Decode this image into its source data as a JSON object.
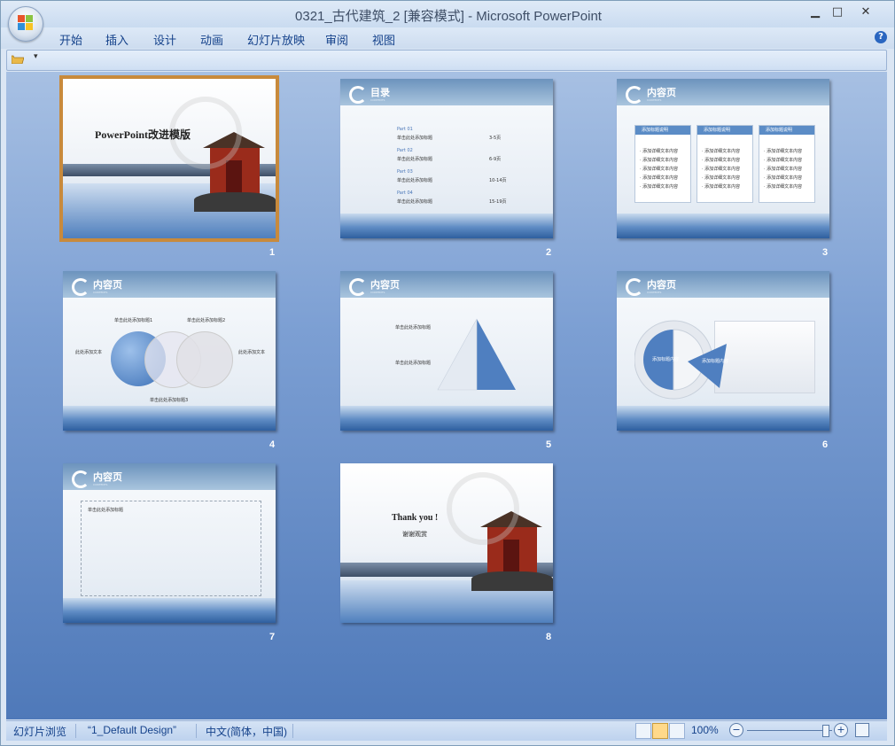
{
  "window": {
    "title": "0321_古代建筑_2 [兼容模式] - Microsoft PowerPoint",
    "minimize": "▁",
    "maximize": "□",
    "close": "✕"
  },
  "menu": {
    "items": [
      "开始",
      "插入",
      "设计",
      "动画",
      "幻灯片放映",
      "审阅",
      "视图"
    ],
    "help": "?"
  },
  "qat": {
    "dropdown": "▾"
  },
  "slides": [
    {
      "number": "1",
      "title": "PowerPoint改进模版"
    },
    {
      "number": "2",
      "header": "目录",
      "subheader": "CONTENTS",
      "parts": [
        {
          "part": "Part 01",
          "text": "单击此处添加标题",
          "pages": "3-5页"
        },
        {
          "part": "Part 02",
          "text": "单击此处添加标题",
          "pages": "6-9页"
        },
        {
          "part": "Part 03",
          "text": "单击此处添加标题",
          "pages": "10-14页"
        },
        {
          "part": "Part 04",
          "text": "单击此处添加标题",
          "pages": "15-19页"
        }
      ]
    },
    {
      "number": "3",
      "header": "内容页",
      "subheader": "CONTENTS",
      "col_title": "添加标题说明",
      "col_item": "· 添加详细文本内容"
    },
    {
      "number": "4",
      "header": "内容页",
      "subheader": "CONTENTS",
      "label1": "单击此处添加标题1",
      "label2": "单击此处添加标题2",
      "label3": "单击此处添加标题3",
      "side": "此处添加文本"
    },
    {
      "number": "5",
      "header": "内容页",
      "subheader": "CONTENTS",
      "label1": "单击此处添加标题",
      "label2": "单击此处添加标题"
    },
    {
      "number": "6",
      "header": "内容页",
      "subheader": "CONTENTS",
      "pie1": "添加标题内容",
      "pie2": "添加标题内容"
    },
    {
      "number": "7",
      "header": "内容页",
      "subheader": "CONTENTS",
      "bullet": "单击此处添加标题"
    },
    {
      "number": "8",
      "title": "Thank you !",
      "subtitle": "谢谢观赏"
    }
  ],
  "status": {
    "view": "幻灯片浏览",
    "theme": "“1_Default Design”",
    "language": "中文(简体，中国)",
    "zoom": "100%",
    "zoom_out": "−",
    "zoom_in": "+"
  },
  "colors": {
    "accent": "#4a77b8",
    "selection": "#c88a3c",
    "status_text": "#15428b"
  }
}
